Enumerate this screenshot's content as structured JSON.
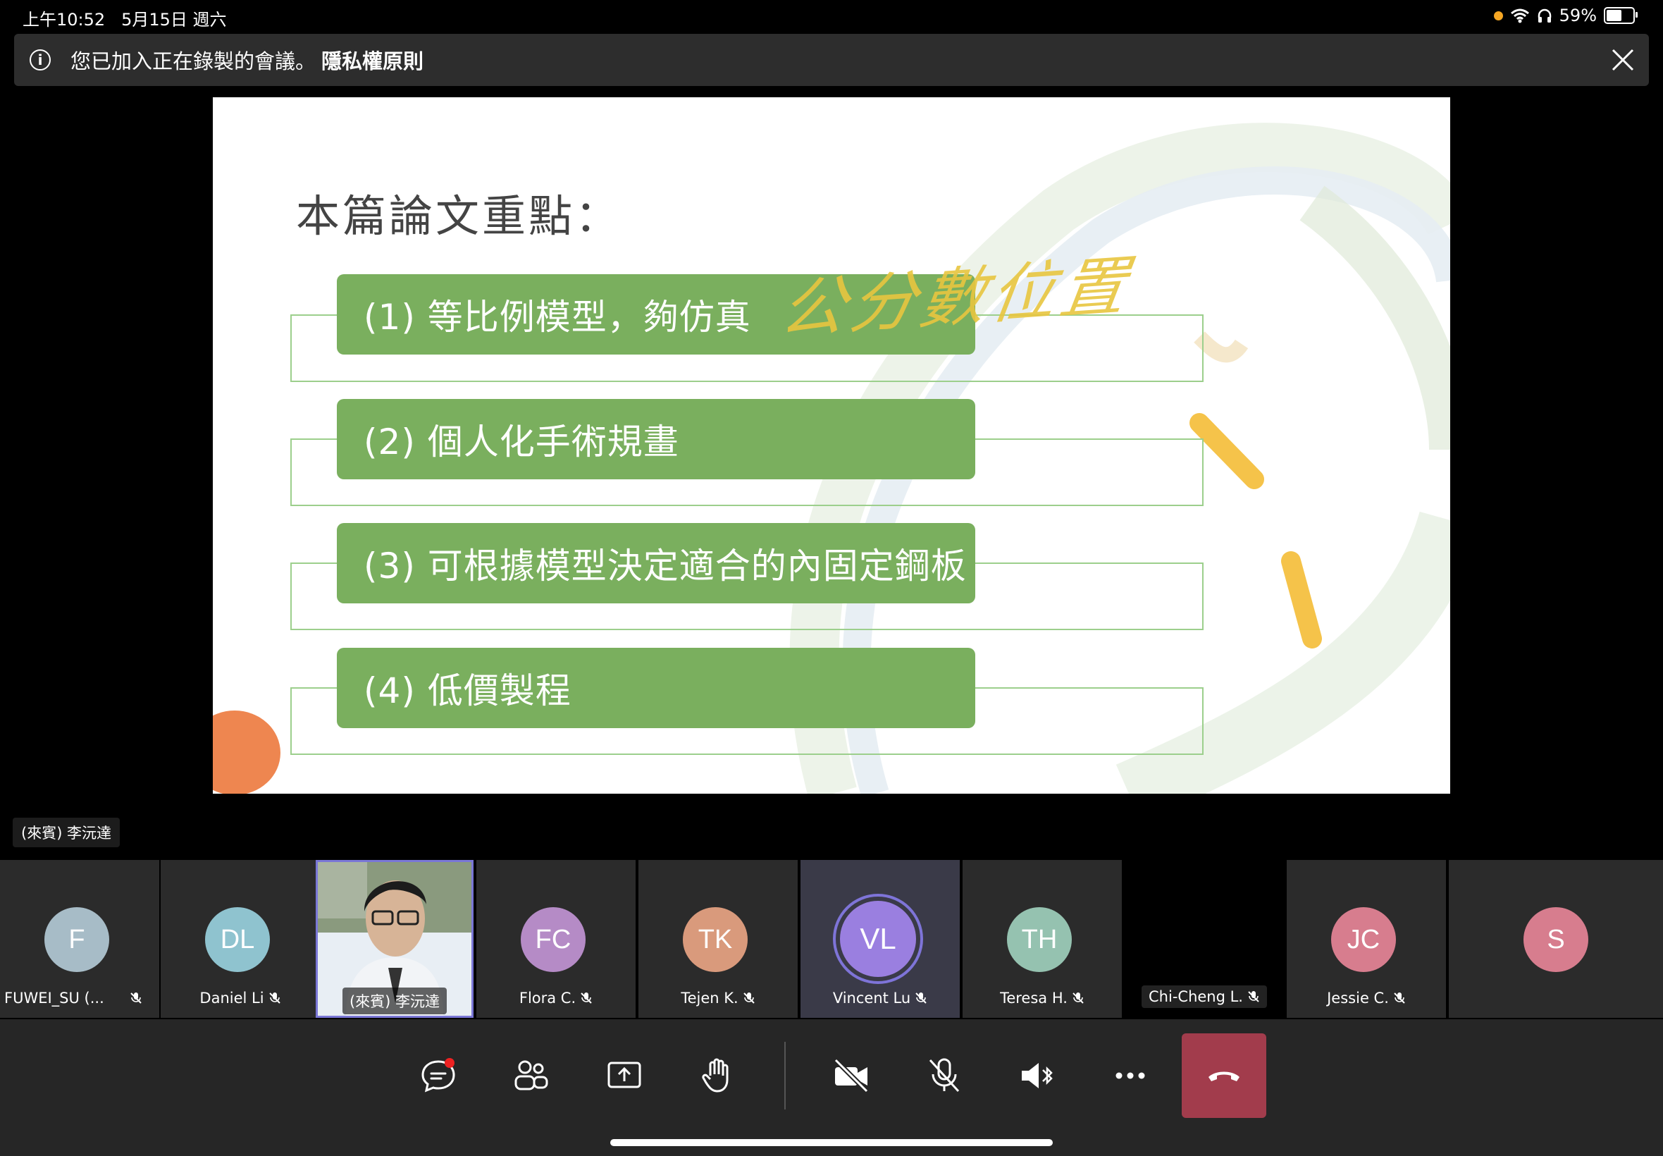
{
  "status_bar": {
    "time": "上午10:52",
    "date": "5月15日 週六",
    "battery": "59%",
    "battery_level": 0.59
  },
  "banner": {
    "message": "您已加入正在錄製的會議。",
    "link": "隱私權原則"
  },
  "slide": {
    "title": "本篇論文重點：",
    "items": [
      "(1) 等比例模型，夠仿真",
      "(2) 個人化手術規畫",
      "(3) 可根據模型決定適合的內固定鋼板",
      "(4) 低價製程"
    ],
    "handwriting": "公分數位置"
  },
  "speaker_label": "(來賓) 李沅達",
  "participants": [
    {
      "initials": "F",
      "name": "FUWEI_SU (...",
      "color": "#a7bcc7"
    },
    {
      "initials": "DL",
      "name": "Daniel Li",
      "color": "#8fc3cf"
    },
    {
      "initials": "",
      "name": "(來賓) 李沅達",
      "color": "#ffffff"
    },
    {
      "initials": "FC",
      "name": "Flora C.",
      "color": "#b58bc6"
    },
    {
      "initials": "TK",
      "name": "Tejen K.",
      "color": "#d99a7c"
    },
    {
      "initials": "VL",
      "name": "Vincent Lu",
      "color": "#9a7fe0"
    },
    {
      "initials": "TH",
      "name": "Teresa H.",
      "color": "#95c2b0"
    },
    {
      "initials": "",
      "name": "Chi-Cheng L.",
      "color": "#000000"
    },
    {
      "initials": "JC",
      "name": "Jessie C.",
      "color": "#d77d8e"
    },
    {
      "initials": "S",
      "name": "",
      "color": "#d77d8e"
    }
  ],
  "controls": [
    {
      "name": "chat-button",
      "icon": "chat-icon"
    },
    {
      "name": "participants-button",
      "icon": "people-icon"
    },
    {
      "name": "share-button",
      "icon": "share-icon"
    },
    {
      "name": "raise-hand-button",
      "icon": "hand-icon"
    },
    {
      "name": "camera-button",
      "icon": "camera-off-icon"
    },
    {
      "name": "mic-button",
      "icon": "mic-off-icon"
    },
    {
      "name": "speaker-button",
      "icon": "speaker-bluetooth-icon"
    },
    {
      "name": "more-button",
      "icon": "more-icon"
    },
    {
      "name": "hangup-button",
      "icon": "hangup-icon"
    }
  ]
}
